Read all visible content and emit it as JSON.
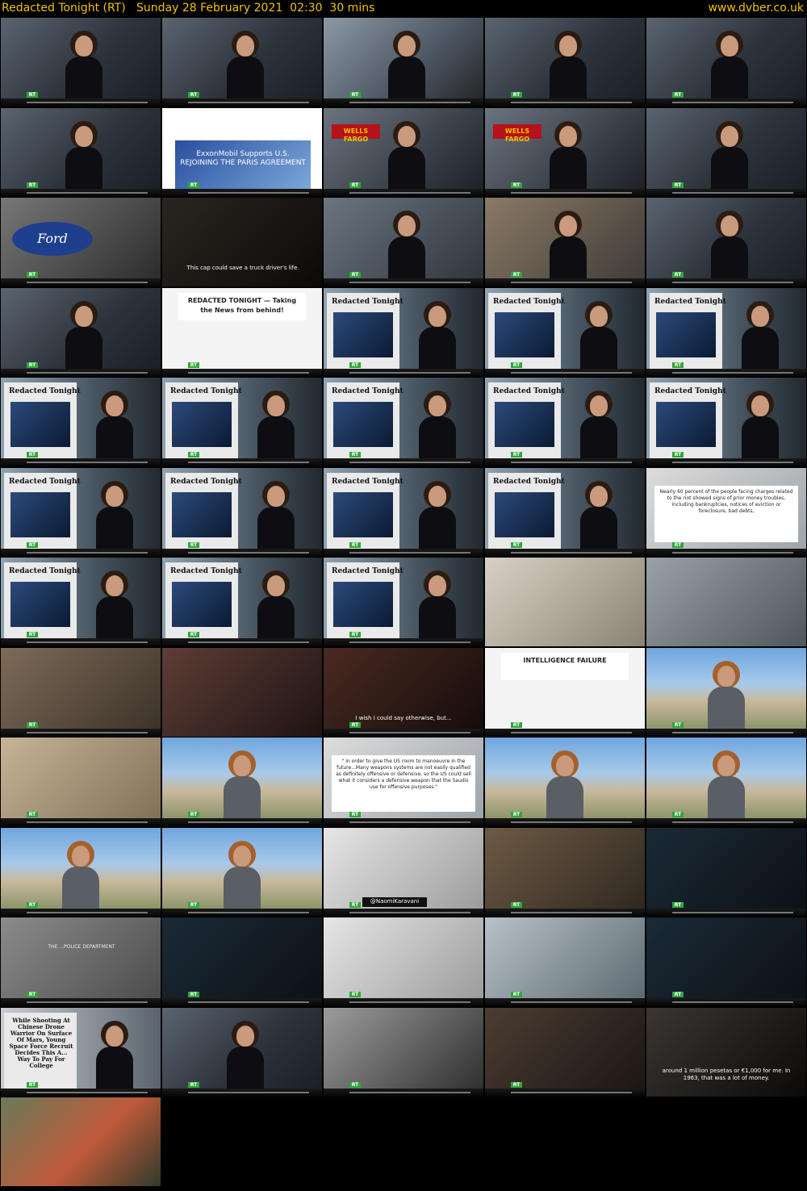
{
  "header": {
    "title": "Redacted Tonight (RT)   Sunday 28 February 2021  02:30  30 mins",
    "site": "www.dvber.co.uk"
  },
  "grid": {
    "columns": 5,
    "thumbnails": [
      {
        "scene": "host-studio",
        "caption": ""
      },
      {
        "scene": "host-studio",
        "caption": ""
      },
      {
        "scene": "host-screen-products",
        "caption": ""
      },
      {
        "scene": "host-studio",
        "caption": ""
      },
      {
        "scene": "host-studio",
        "caption": ""
      },
      {
        "scene": "host-studio",
        "caption": ""
      },
      {
        "scene": "tweet-exxon",
        "caption": "ExxonMobil Supports U.S. REJOINING THE PARIS AGREEMENT"
      },
      {
        "scene": "host-wells-fargo",
        "caption": "WELLS FARGO"
      },
      {
        "scene": "host-wells-fargo",
        "caption": "WELLS FARGO"
      },
      {
        "scene": "host-studio",
        "caption": ""
      },
      {
        "scene": "ford-logo",
        "caption": "Ford"
      },
      {
        "scene": "dark-ad",
        "caption": "This cap could save a truck driver's life"
      },
      {
        "scene": "host-screen",
        "caption": ""
      },
      {
        "scene": "host-screen-warehouse",
        "caption": ""
      },
      {
        "scene": "host-studio",
        "caption": ""
      },
      {
        "scene": "host-studio",
        "caption": ""
      },
      {
        "scene": "newspaper-cover",
        "caption": "REDACTED TONIGHT — Taking the News from behind!"
      },
      {
        "scene": "host-paper",
        "caption": "Redacted Tonight"
      },
      {
        "scene": "host-paper",
        "caption": "Redacted Tonight"
      },
      {
        "scene": "host-paper",
        "caption": "Redacted Tonight"
      },
      {
        "scene": "host-paper",
        "caption": "Redacted Tonight"
      },
      {
        "scene": "host-paper",
        "caption": "Redacted Tonight"
      },
      {
        "scene": "host-paper",
        "caption": "Redacted Tonight"
      },
      {
        "scene": "host-paper",
        "caption": "Redacted Tonight"
      },
      {
        "scene": "host-paper",
        "caption": "Redacted Tonight"
      },
      {
        "scene": "host-paper",
        "caption": "Redacted Tonight"
      },
      {
        "scene": "host-paper",
        "caption": "Redacted Tonight"
      },
      {
        "scene": "host-paper",
        "caption": "Redacted Tonight"
      },
      {
        "scene": "host-paper",
        "caption": "Redacted Tonight"
      },
      {
        "scene": "quote-card",
        "caption": "Nearly 60 percent of the people facing charges related to the riot showed signs of prior money troubles, including bankruptcies, notices of eviction or foreclosure, bad debts,"
      },
      {
        "scene": "host-paper",
        "caption": "Redacted Tonight"
      },
      {
        "scene": "host-paper",
        "caption": "Redacted Tonight"
      },
      {
        "scene": "host-paper",
        "caption": "Redacted Tonight"
      },
      {
        "scene": "guest-library",
        "caption": ""
      },
      {
        "scene": "interview-room",
        "caption": ""
      },
      {
        "scene": "street-footage",
        "caption": ""
      },
      {
        "scene": "hallway",
        "caption": ""
      },
      {
        "scene": "doorway",
        "caption": "I wish I could say otherwise, but..."
      },
      {
        "scene": "newspaper-intel",
        "caption": "INTELLIGENCE FAILURE"
      },
      {
        "scene": "reporter-pentagon",
        "caption": ""
      },
      {
        "scene": "desert-wreck",
        "caption": ""
      },
      {
        "scene": "reporter-pentagon",
        "caption": ""
      },
      {
        "scene": "quote-mee",
        "caption": "\" in order to give the US room to manoeuvre in the future...Many weapons systems are not easily qualified as definitely offensive or defensive, so the US could sell what it considers a defensive weapon that the Saudis use for offensive purposes.\""
      },
      {
        "scene": "reporter-pentagon",
        "caption": ""
      },
      {
        "scene": "reporter-pentagon",
        "caption": ""
      },
      {
        "scene": "reporter-pentagon",
        "caption": ""
      },
      {
        "scene": "reporter-pentagon",
        "caption": ""
      },
      {
        "scene": "anchor-woman",
        "caption": "@NaomiKaravani"
      },
      {
        "scene": "warehouse",
        "caption": ""
      },
      {
        "scene": "studio-wide",
        "caption": ""
      },
      {
        "scene": "police-building",
        "caption": "THE ...POLICE DEPARTMENT"
      },
      {
        "scene": "studio-wide",
        "caption": ""
      },
      {
        "scene": "anchor-woman",
        "caption": ""
      },
      {
        "scene": "vaccine-car",
        "caption": ""
      },
      {
        "scene": "studio-wide",
        "caption": ""
      },
      {
        "scene": "host-paper-space",
        "caption": "While Shooting At Chinese Drone Warrior On Surface Of Mars, Young Space Force Recruit Decides This A... Way To Pay For College"
      },
      {
        "scene": "host-studio",
        "caption": ""
      },
      {
        "scene": "bw-hospital",
        "caption": ""
      },
      {
        "scene": "old-man-sitting",
        "caption": ""
      },
      {
        "scene": "closeup-eye",
        "caption": "around 1 million pesetas or €1,000 for me. In 1963, that was a lot of money."
      },
      {
        "scene": "jungle-fire",
        "caption": ""
      }
    ]
  },
  "colors": {
    "header_text": "#f2c200",
    "background": "#000000",
    "rt_green": "#2fa73a"
  }
}
